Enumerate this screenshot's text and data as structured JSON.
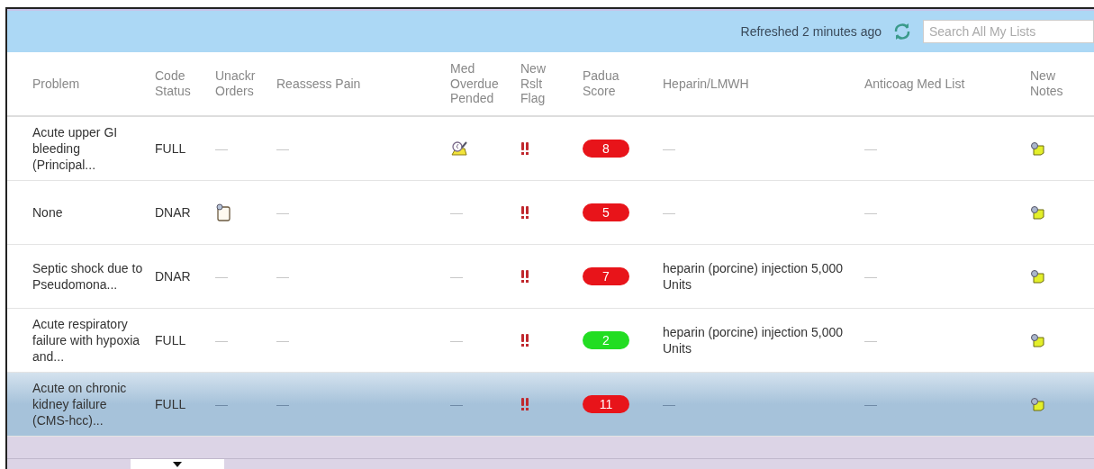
{
  "toolbar": {
    "refreshed": "Refreshed 2 minutes ago",
    "search": {
      "placeholder": "Search All My Lists"
    }
  },
  "columns": [
    "Problem",
    "Code Status",
    "Unackr Orders",
    "Reassess Pain",
    "Med Overdue Pended",
    "New Rslt Flag",
    "Padua Score",
    "Heparin/LMWH",
    "Anticoag Med List",
    "New Notes"
  ],
  "rows": [
    {
      "selected": false,
      "problem": "Acute upper GI bleeding (Principal...",
      "code_status": "FULL",
      "unackr_orders": {
        "kind": "text",
        "text": "—"
      },
      "reassess_pain": "—",
      "med_overdue": {
        "kind": "med_icon"
      },
      "new_result_flag": true,
      "padua": {
        "text": "8",
        "color": "#e8141a"
      },
      "heparin": "—",
      "anticoag": "—",
      "new_notes": true
    },
    {
      "selected": false,
      "problem": "None",
      "code_status": "DNAR",
      "unackr_orders": {
        "kind": "orders_icon"
      },
      "reassess_pain": "—",
      "med_overdue": {
        "kind": "text",
        "text": "—"
      },
      "new_result_flag": true,
      "padua": {
        "text": "5",
        "color": "#e8141a"
      },
      "heparin": "—",
      "anticoag": "—",
      "new_notes": true
    },
    {
      "selected": false,
      "problem": "Septic shock due to Pseudomona...",
      "code_status": "DNAR",
      "unackr_orders": {
        "kind": "text",
        "text": "—"
      },
      "reassess_pain": "—",
      "med_overdue": {
        "kind": "text",
        "text": "—"
      },
      "new_result_flag": true,
      "padua": {
        "text": "7",
        "color": "#e8141a"
      },
      "heparin": "heparin (porcine) injection 5,000 Units",
      "anticoag": "—",
      "new_notes": true
    },
    {
      "selected": false,
      "problem": "Acute respiratory failure with hypoxia and...",
      "code_status": "FULL",
      "unackr_orders": {
        "kind": "text",
        "text": "—"
      },
      "reassess_pain": "—",
      "med_overdue": {
        "kind": "text",
        "text": "—"
      },
      "new_result_flag": true,
      "padua": {
        "text": "2",
        "color": "#22dd22"
      },
      "heparin": "heparin (porcine) injection 5,000 Units",
      "anticoag": "—",
      "new_notes": true
    },
    {
      "selected": true,
      "problem": "Acute on chronic kidney failure (CMS-hcc)...",
      "code_status": "FULL",
      "unackr_orders": {
        "kind": "text",
        "text": "—"
      },
      "reassess_pain": "—",
      "med_overdue": {
        "kind": "text",
        "text": "—"
      },
      "new_result_flag": true,
      "padua": {
        "text": "11",
        "color": "#e8141a"
      },
      "heparin": "—",
      "anticoag": "—",
      "new_notes": true
    }
  ]
}
